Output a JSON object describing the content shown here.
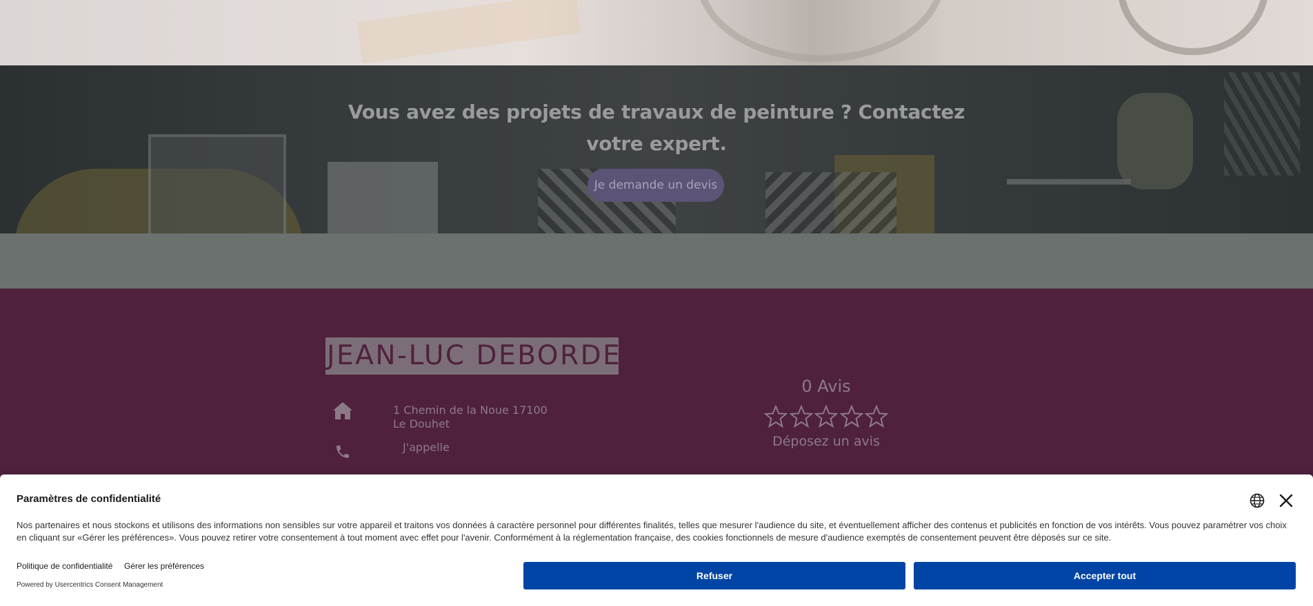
{
  "cta": {
    "title": "Vous avez des projets de travaux de peinture ? Contactez votre expert.",
    "button_label": "Je demande un devis"
  },
  "footer": {
    "logo_text": "JEAN-LUC DEBORDE",
    "address_line1": "1 Chemin de la Noue 17100",
    "address_line2": "Le Douhet",
    "phone_label": "J'appelle",
    "reviews_count": "0 Avis",
    "rating": 0,
    "rating_max": 5,
    "review_link": "Déposez un avis"
  },
  "consent": {
    "title": "Paramètres de confidentialité",
    "text": "Nos partenaires et nous stockons et utilisons des informations non sensibles sur votre appareil et traitons vos données à caractère personnel pour différentes finalités, telles que mesurer l'audience du site, et éventuellement afficher des contenus et publicités en fonction de vos intérêts. Vous pouvez paramétrer vos choix en cliquant sur «Gérer les préférences». Vous pouvez retirer votre consentement à tout moment avec effet pour l'avenir. Conformément à la réglementation française, des cookies fonctionnels de mesure d'audience exemptés de consentement peuvent être déposés sur ce site.",
    "privacy_link": "Politique de confidentialité",
    "prefs_link": "Gérer les préférences",
    "powered_by": "Powered by Usercentrics Consent Management",
    "refuse_label": "Refuser",
    "accept_label": "Accepter tout",
    "button_color": "#0045a5"
  },
  "colors": {
    "footer_bg": "#4f213c",
    "cta_button_bg": "#5c5477"
  },
  "icons": [
    "globe-icon",
    "close-icon",
    "home-icon",
    "phone-icon",
    "star-outline-icon"
  ]
}
